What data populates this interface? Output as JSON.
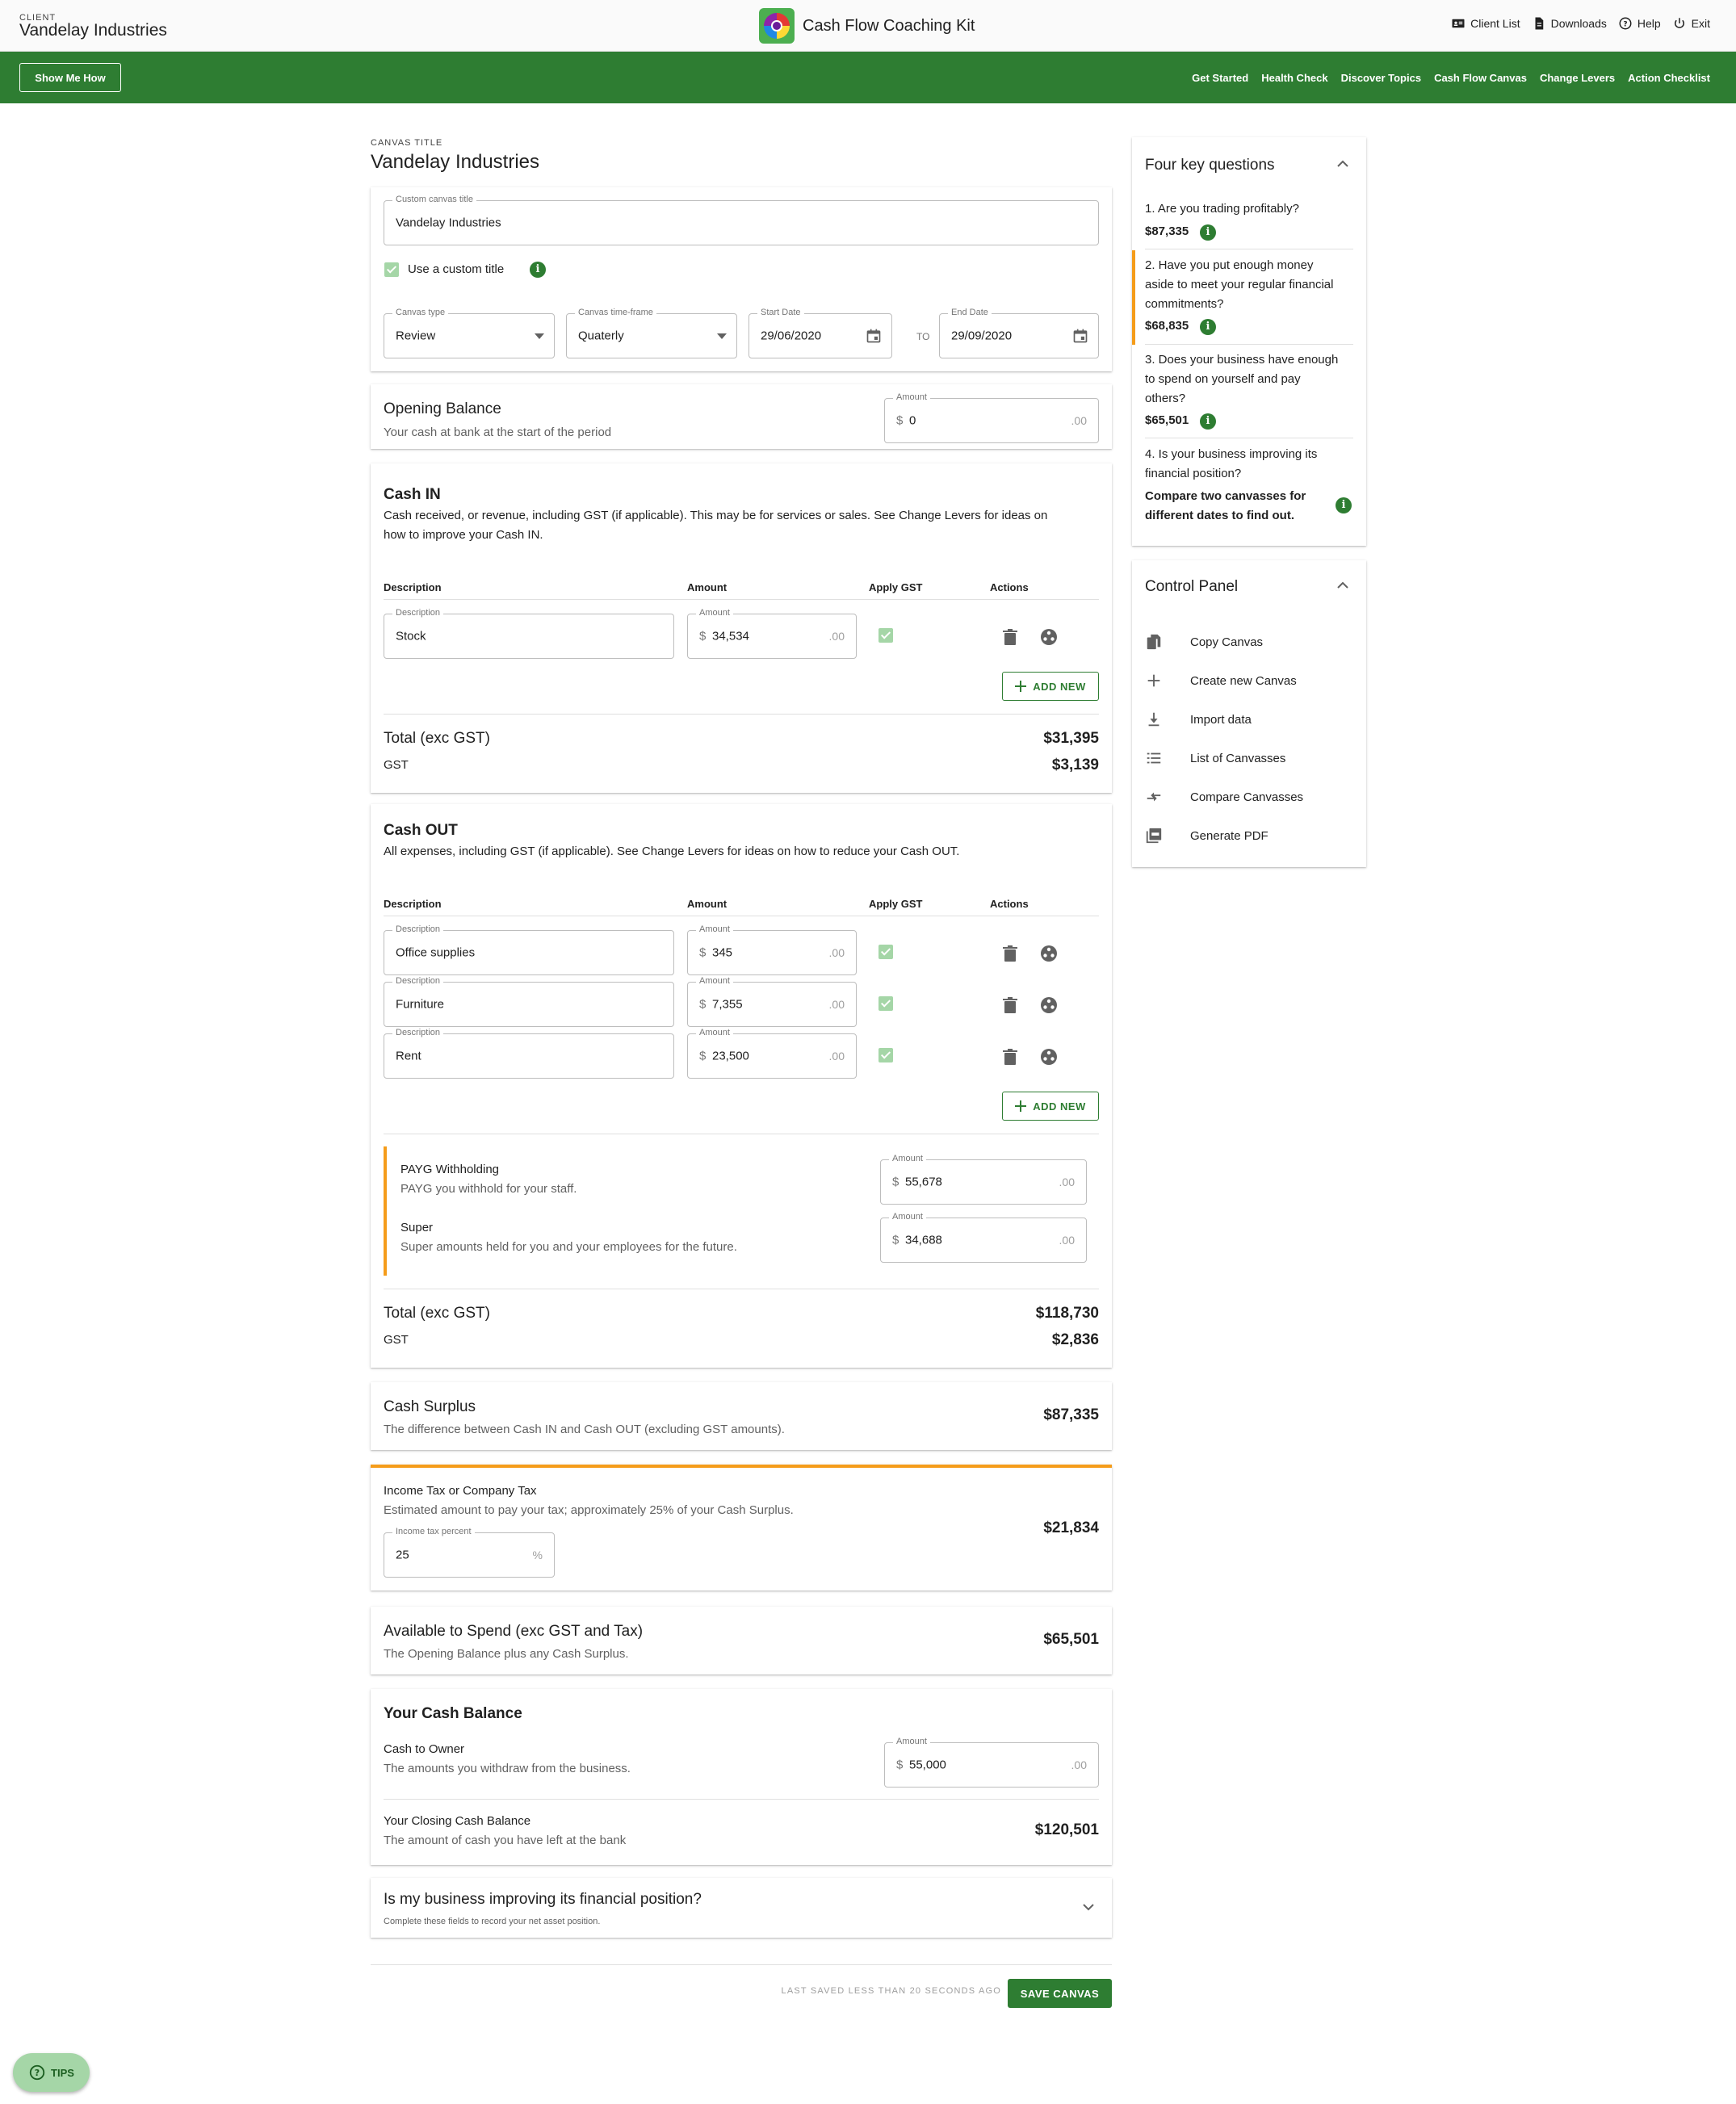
{
  "topbar": {
    "client_label": "CLIENT",
    "client_name": "Vandelay Industries",
    "app_title": "Cash Flow Coaching Kit",
    "links": [
      "Client List",
      "Downloads",
      "Help",
      "Exit"
    ]
  },
  "nav": {
    "show_me_how": "Show Me How",
    "items": [
      "Get Started",
      "Health Check",
      "Discover Topics",
      "Cash Flow Canvas",
      "Change Levers",
      "Action Checklist"
    ]
  },
  "canvas": {
    "title_label": "CANVAS TITLE",
    "title": "Vandelay Industries",
    "custom_title_label": "Custom canvas title",
    "custom_title_value": "Vandelay Industries",
    "use_custom_title": "Use a custom title",
    "type_label": "Canvas type",
    "type_value": "Review",
    "timeframe_label": "Canvas time-frame",
    "timeframe_value": "Quaterly",
    "start_label": "Start Date",
    "start_value": "29/06/2020",
    "to": "TO",
    "end_label": "End Date",
    "end_value": "29/09/2020"
  },
  "opening": {
    "title": "Opening Balance",
    "subtitle": "Your cash at bank at the start of the period",
    "amount_label": "Amount",
    "currency": "$",
    "amount": "0",
    "cents": ".00"
  },
  "cash_in": {
    "title": "Cash IN",
    "desc_line1": "Cash received, or revenue, including GST (if applicable). This may be for services or sales. See Change Levers for ideas on",
    "desc_line2": "how to improve your Cash IN.",
    "col_desc": "Description",
    "col_amount": "Amount",
    "col_gst": "Apply GST",
    "col_actions": "Actions",
    "rows": [
      {
        "desc_label": "Description",
        "desc": "Stock",
        "amt_label": "Amount",
        "amount": "34,534",
        "cents": ".00"
      }
    ],
    "add_new": "ADD NEW",
    "total_label": "Total (exc GST)",
    "total": "$31,395",
    "gst_label": "GST",
    "gst": "$3,139"
  },
  "cash_out": {
    "title": "Cash OUT",
    "desc": "All expenses, including GST (if applicable). See Change Levers for ideas on how to reduce your Cash OUT.",
    "col_desc": "Description",
    "col_amount": "Amount",
    "col_gst": "Apply GST",
    "col_actions": "Actions",
    "rows": [
      {
        "desc_label": "Description",
        "desc": "Office supplies",
        "amt_label": "Amount",
        "amount": "345",
        "cents": ".00"
      },
      {
        "desc_label": "Description",
        "desc": "Furniture",
        "amt_label": "Amount",
        "amount": "7,355",
        "cents": ".00"
      },
      {
        "desc_label": "Description",
        "desc": "Rent",
        "amt_label": "Amount",
        "amount": "23,500",
        "cents": ".00"
      }
    ],
    "add_new": "ADD NEW",
    "payg_title": "PAYG Withholding",
    "payg_sub": "PAYG you withhold for your staff.",
    "payg_label": "Amount",
    "payg_amount": "55,678",
    "super_title": "Super",
    "super_sub": "Super amounts held for you and your employees for the future.",
    "super_label": "Amount",
    "super_amount": "34,688",
    "cents": ".00",
    "total_label": "Total (exc GST)",
    "total": "$118,730",
    "gst_label": "GST",
    "gst": "$2,836"
  },
  "surplus": {
    "title": "Cash Surplus",
    "subtitle": "The difference between Cash IN and Cash OUT (excluding GST amounts).",
    "amount": "$87,335"
  },
  "tax": {
    "title": "Income Tax or Company Tax",
    "subtitle": "Estimated amount to pay your tax; approximately 25% of your Cash Surplus.",
    "percent_label": "Income tax percent",
    "percent": "25",
    "percent_suffix": "%",
    "amount": "$21,834"
  },
  "available": {
    "title": "Available to Spend (exc GST and Tax)",
    "subtitle": "The Opening Balance plus any Cash Surplus.",
    "amount": "$65,501"
  },
  "balance": {
    "title": "Your Cash Balance",
    "owner_title": "Cash to Owner",
    "owner_sub": "The amounts you withdraw from the business.",
    "owner_label": "Amount",
    "owner_amount": "55,000",
    "cents": ".00",
    "closing_title": "Your Closing Cash Balance",
    "closing_sub": "The amount of cash you have left at the bank",
    "closing_amount": "$120,501"
  },
  "improving": {
    "title": "Is my business improving its financial position?",
    "subtitle": "Complete these fields to record your net asset position."
  },
  "footer": {
    "last_saved": "LAST SAVED LESS THAN 20 SECONDS AGO",
    "save": "SAVE CANVAS",
    "tips": "TIPS"
  },
  "questions": {
    "title": "Four key questions",
    "q1": "1. Are you trading profitably?",
    "q1_amount": "$87,335",
    "q2_l1": "2. Have you put enough money",
    "q2_l2": "aside to meet your regular financial",
    "q2_l3": "commitments?",
    "q2_amount": "$68,835",
    "q3_l1": "3. Does your business have enough",
    "q3_l2": "to spend on yourself and pay",
    "q3_l3": "others?",
    "q3_amount": "$65,501",
    "q4_l1": "4. Is your business improving its",
    "q4_l2": "financial position?",
    "q4_note_l1": "Compare two canvasses for",
    "q4_note_l2": "different dates to find out."
  },
  "control_panel": {
    "title": "Control Panel",
    "items": [
      "Copy Canvas",
      "Create new Canvas",
      "Import data",
      "List of Canvasses",
      "Compare Canvasses",
      "Generate PDF"
    ]
  },
  "colors": {
    "primary": "#2e7d32",
    "accent": "#f59c1a",
    "check": "#a5d6a7"
  }
}
